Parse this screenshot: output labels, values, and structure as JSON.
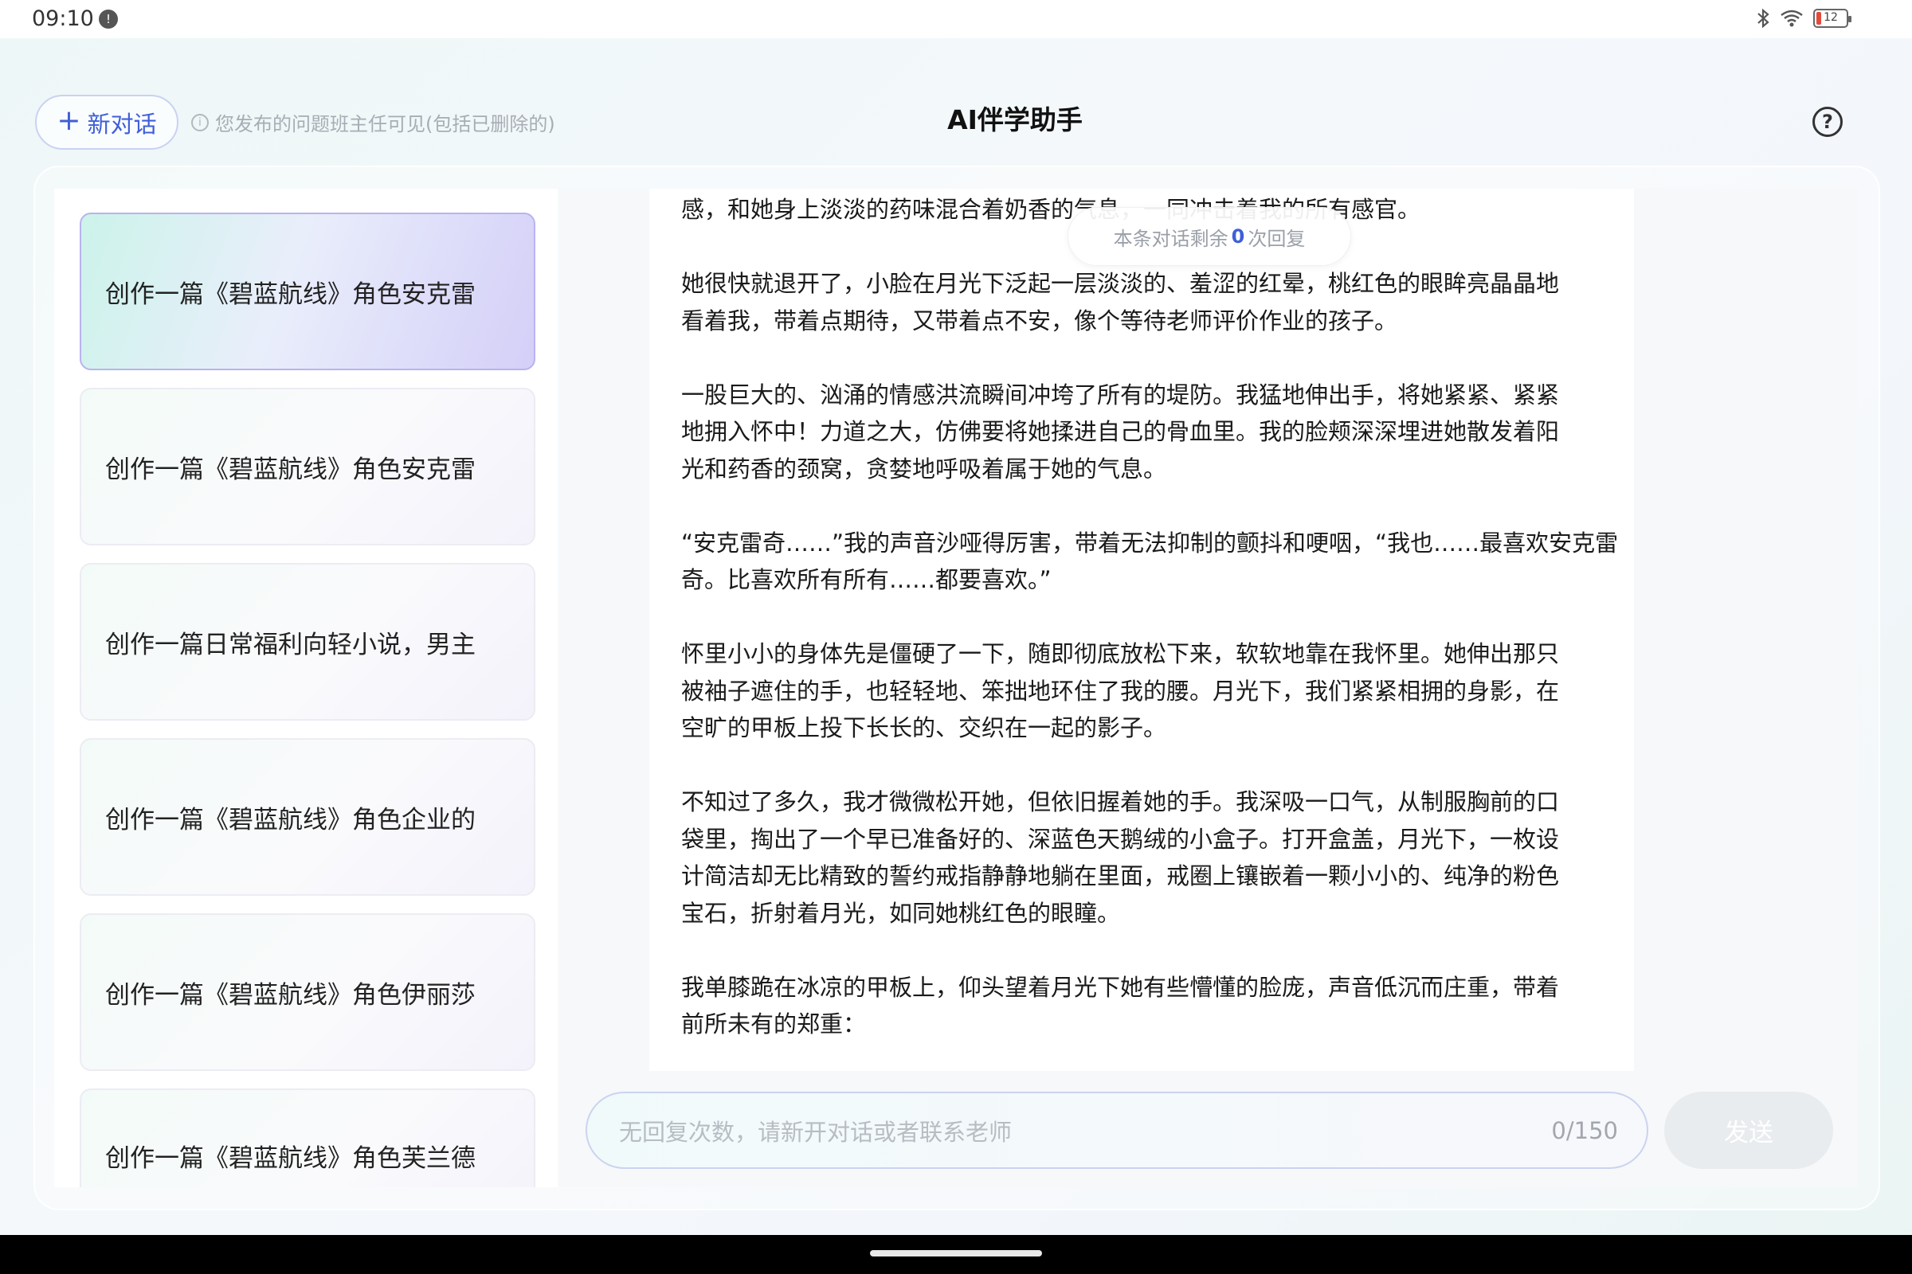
{
  "status_bar": {
    "time": "09:10",
    "notification_badge": "!",
    "battery_level": "12",
    "battery_color": "#e34a3c"
  },
  "header": {
    "new_chat_icon": "+",
    "new_chat_label": "新对话",
    "notice_icon": "i",
    "notice_text": "您发布的问题班主任可见(包括已删除的)",
    "title": "AI伴学助手",
    "help_icon": "?"
  },
  "sidebar": {
    "items": [
      {
        "label": "创作一篇《碧蓝航线》角色安克雷",
        "active": true
      },
      {
        "label": "创作一篇《碧蓝航线》角色安克雷",
        "active": false
      },
      {
        "label": "创作一篇日常福利向轻小说，男主",
        "active": false
      },
      {
        "label": "创作一篇《碧蓝航线》角色企业的",
        "active": false
      },
      {
        "label": "创作一篇《碧蓝航线》角色伊丽莎",
        "active": false
      },
      {
        "label": "创作一篇《碧蓝航线》角色芙兰德",
        "active": false
      }
    ]
  },
  "chat": {
    "remaining": {
      "prefix": "本条对话剩余",
      "count": "0",
      "suffix": "次回复"
    },
    "paragraphs": [
      [
        "感，和她身上淡淡的药味混合着奶香的气息，一同冲击着我的所有感官。"
      ],
      [
        "她很快就退开了，小脸在月光下泛起一层淡淡的、羞涩的红晕，桃红色的眼眸亮晶晶地",
        "看着我，带着点期待，又带着点不安，像个等待老师评价作业的孩子。"
      ],
      [
        "一股巨大的、汹涌的情感洪流瞬间冲垮了所有的堤防。我猛地伸出手，将她紧紧、紧紧",
        "地拥入怀中！力道之大，仿佛要将她揉进自己的骨血里。我的脸颊深深埋进她散发着阳",
        "光和药香的颈窝，贪婪地呼吸着属于她的气息。"
      ],
      [
        "“安克雷奇……”我的声音沙哑得厉害，带着无法抑制的颤抖和哽咽，“我也……最喜欢安克雷",
        "奇。比喜欢所有所有……都要喜欢。”"
      ],
      [
        "怀里小小的身体先是僵硬了一下，随即彻底放松下来，软软地靠在我怀里。她伸出那只",
        "被袖子遮住的手，也轻轻地、笨拙地环住了我的腰。月光下，我们紧紧相拥的身影，在",
        "空旷的甲板上投下长长的、交织在一起的影子。"
      ],
      [
        "不知过了多久，我才微微松开她，但依旧握着她的手。我深吸一口气，从制服胸前的口",
        "袋里，掏出了一个早已准备好的、深蓝色天鹅绒的小盒子。打开盒盖，月光下，一枚设",
        "计简洁却无比精致的誓约戒指静静地躺在里面，戒圈上镶嵌着一颗小小的、纯净的粉色",
        "宝石，折射着月光，如同她桃红色的眼瞳。"
      ],
      [
        "我单膝跪在冰凉的甲板上，仰头望着月光下她有些懵懂的脸庞，声音低沉而庄重，带着",
        "前所未有的郑重："
      ]
    ]
  },
  "composer": {
    "placeholder": "无回复次数，请新开对话或者联系老师",
    "counter": "0/150",
    "send_label": "发送"
  },
  "colors": {
    "accent": "#3f5fd8",
    "active_item_border": "#b9b3f0",
    "send_disabled": "#e9ecef"
  }
}
